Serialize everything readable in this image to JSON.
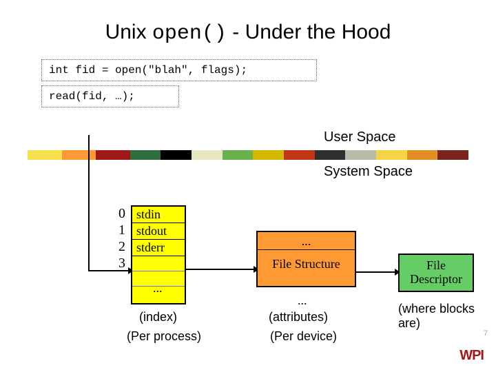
{
  "title_pre": "Unix ",
  "title_mono": "open()",
  "title_post": " - Under the Hood",
  "code_line1": "int fid = open(\"blah\", flags);",
  "code_line2": "read(fid, …);",
  "label_user": "User Space",
  "label_system": "System Space",
  "fdt": {
    "nums": [
      "0",
      "1",
      "2",
      "3"
    ],
    "rows": [
      "stdin",
      "stdout",
      "stderr"
    ],
    "ellipsis": "...",
    "cap1": "(index)",
    "cap2": "(Per process)"
  },
  "fs": {
    "upper": "...",
    "lower": "File Structure",
    "ellipsis": "...",
    "cap1": "(attributes)",
    "cap2": "(Per device)"
  },
  "fd": {
    "label": "File Descriptor",
    "cap": "(where blocks are)"
  },
  "stripe_colors": [
    "#f4e04d",
    "#ff9933",
    "#a01818",
    "#2f6f3f",
    "#000000",
    "#e8e8c0",
    "#6ab04c",
    "#d4b800",
    "#c23616",
    "#2f2f2f",
    "#bba",
    "#f5d548",
    "#e58e26",
    "#7b241c"
  ],
  "page_num": "7",
  "logo_text": "WPI"
}
